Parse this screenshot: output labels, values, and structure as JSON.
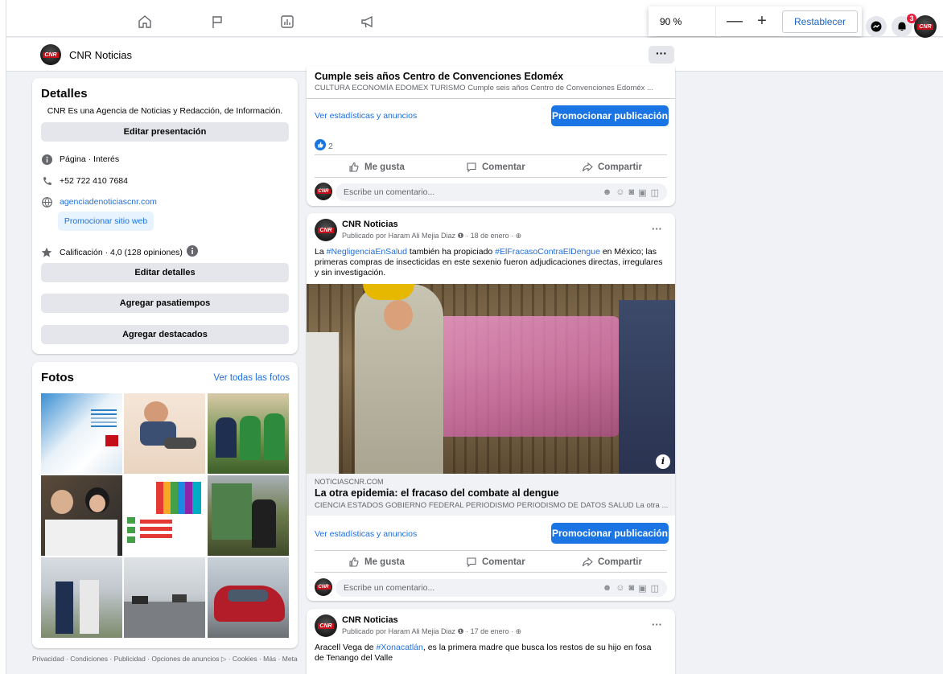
{
  "browser": {
    "zoom": {
      "value": "90 %",
      "minus": "—",
      "plus": "+",
      "reset": "Restablecer"
    },
    "notifications_count": "3"
  },
  "page": {
    "name": "CNR Noticias",
    "more": "···"
  },
  "details": {
    "title": "Detalles",
    "bio": "CNR Es una Agencia de Noticias y Redacción, de Información.",
    "edit_intro": "Editar presentación",
    "category": "Página · Interés",
    "phone": "+52 722 410 7684",
    "website": "agenciadenoticiascnr.com",
    "promote_site": "Promocionar sitio web",
    "rating": "Calificación · 4,0 (128 opiniones)",
    "edit_details": "Editar detalles",
    "add_hobbies": "Agregar pasatiempos",
    "add_featured": "Agregar destacados"
  },
  "photos": {
    "title": "Fotos",
    "see_all": "Ver todas las fotos"
  },
  "footer": "Privacidad · Condiciones · Publicidad · Opciones de anuncios ▷ · Cookies · Más · Meta",
  "post1": {
    "link_title": "Cumple seis años Centro de Convenciones Edoméx",
    "link_sub": "CULTURA ECONOMÍA EDOMEX TURISMO Cumple seis años Centro de Convenciones Edoméx ...",
    "stats": "Ver estadísticas y anuncios",
    "promote": "Promocionar publicación",
    "likes": "2",
    "like": "Me gusta",
    "comment": "Comentar",
    "share": "Compartir",
    "comment_placeholder": "Escribe un comentario..."
  },
  "post2": {
    "author": "CNR Noticias",
    "byline": "Publicado por Haram Ali Mejia Diaz ❶ · 18 de enero · ⊕",
    "text_1": "La ",
    "tag_1": "#NegligenciaEnSalud",
    "text_2": " también ha propiciado ",
    "tag_2": "#ElFracasoContraElDengue",
    "text_3": " en México; las primeras compras de insecticidas en este sexenio fueron adjudicaciones directas, irregulares y sin investigación.",
    "domain": "NOTICIASCNR.COM",
    "link_title": "La otra epidemia: el fracaso del combate al dengue",
    "link_sub": "CIENCIA ESTADOS GOBIERNO FEDERAL PERIODISMO PERIODISMO DE DATOS SALUD La otra ...",
    "stats": "Ver estadísticas y anuncios",
    "promote": "Promocionar publicación",
    "like": "Me gusta",
    "comment": "Comentar",
    "share": "Compartir",
    "comment_placeholder": "Escribe un comentario..."
  },
  "post3": {
    "author": "CNR Noticias",
    "byline": "Publicado por Haram Ali Mejia Diaz ❶ · 17 de enero · ⊕",
    "text_1": "Aracell Vega de ",
    "tag_1": "#Xonacatlán",
    "text_2": ", es la primera madre que busca los restos de su hijo en fosa de Tenango del Valle"
  },
  "colors": {
    "accent": "#1b74e4",
    "link": "#216fdb",
    "badge": "#e41e3f"
  }
}
